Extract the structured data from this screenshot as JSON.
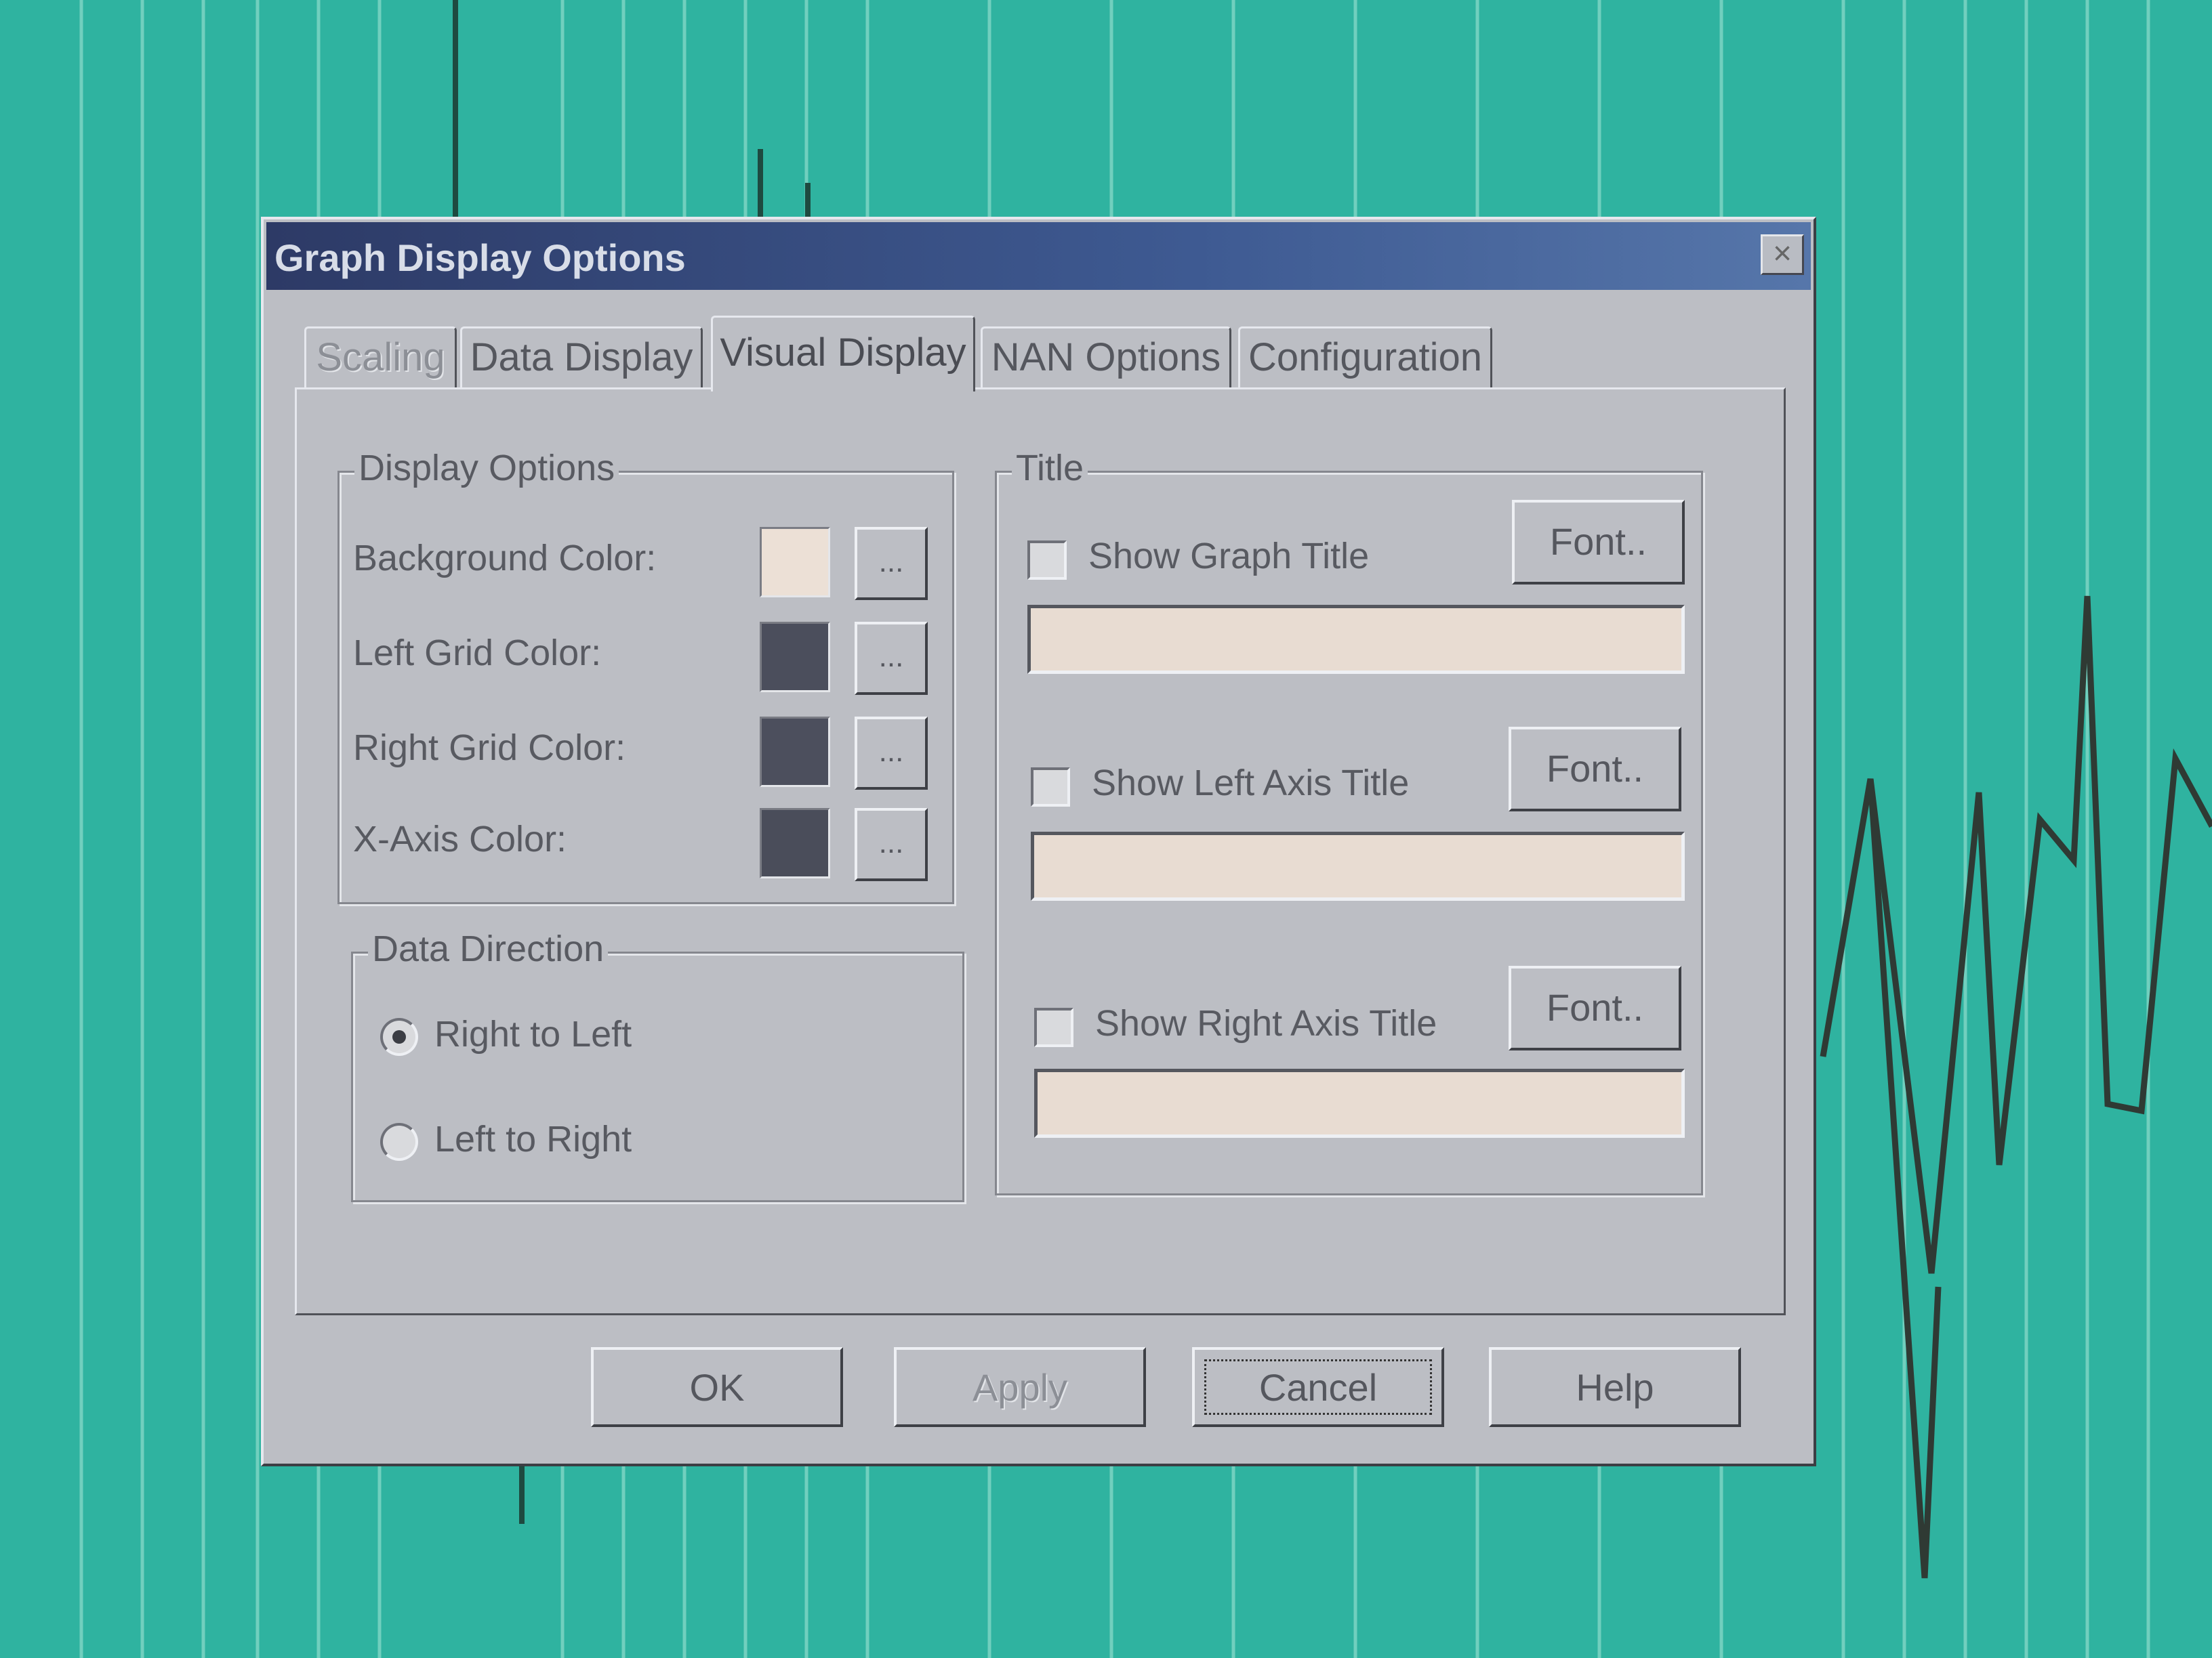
{
  "window": {
    "title": "Graph Display Options",
    "close_glyph": "×"
  },
  "tabs": [
    {
      "label": "Scaling",
      "state": "disabled"
    },
    {
      "label": "Data Display",
      "state": "normal"
    },
    {
      "label": "Visual Display",
      "state": "active"
    },
    {
      "label": "NAN Options",
      "state": "normal"
    },
    {
      "label": "Configuration",
      "state": "normal"
    }
  ],
  "display_options": {
    "legend": "Display Options",
    "rows": [
      {
        "label": "Background Color:",
        "color": "#ece0d6",
        "button": "..."
      },
      {
        "label": "Left Grid Color:",
        "color": "#4b4e5c",
        "button": "..."
      },
      {
        "label": "Right Grid Color:",
        "color": "#4c4f5d",
        "button": "..."
      },
      {
        "label": "X-Axis Color:",
        "color": "#4a4d5a",
        "button": "..."
      }
    ]
  },
  "data_direction": {
    "legend": "Data Direction",
    "options": [
      {
        "label": "Right to Left",
        "selected": true
      },
      {
        "label": "Left to Right",
        "selected": false
      }
    ]
  },
  "title_group": {
    "legend": "Title",
    "rows": [
      {
        "checkbox_label": "Show Graph Title",
        "checked": false,
        "font_button": "Font..",
        "value": ""
      },
      {
        "checkbox_label": "Show Left Axis Title",
        "checked": false,
        "font_button": "Font..",
        "value": ""
      },
      {
        "checkbox_label": "Show Right Axis Title",
        "checked": false,
        "font_button": "Font..",
        "value": ""
      }
    ]
  },
  "footer": {
    "ok": "OK",
    "apply": "Apply",
    "cancel": "Cancel",
    "help": "Help"
  },
  "colors": {
    "desktop": "#2fb3a0",
    "dialog": "#bcbec4",
    "titlebar": "#2d3a66"
  }
}
